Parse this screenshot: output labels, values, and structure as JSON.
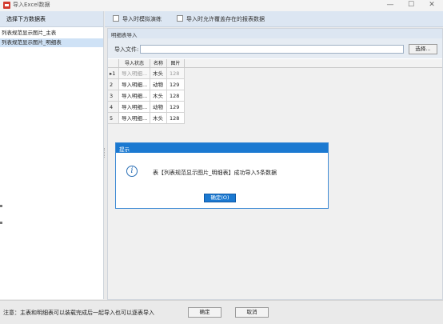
{
  "window": {
    "title": "导入Excel数据",
    "minimize": "—",
    "maximize": "☐",
    "close": "✕"
  },
  "left_panel": {
    "header": "选择下方数据表",
    "items": [
      {
        "label": "列表规范显示图片_主表",
        "selected": false
      },
      {
        "label": "列表规范显示图片_明细表",
        "selected": true
      }
    ]
  },
  "options": {
    "simulate_label": "导入时模拟演练",
    "allow_overwrite_label": "导入时允许覆盖存在的报表数据"
  },
  "group": {
    "title": "明细表导入",
    "file_label": "导入文件:",
    "file_value": "",
    "browse_label": "选择..."
  },
  "grid": {
    "columns": [
      "",
      "导入状态",
      "名称",
      "图片"
    ],
    "rows": [
      {
        "num": "1",
        "status": "导入明细...",
        "name": "木头",
        "pic": "128",
        "current": true
      },
      {
        "num": "2",
        "status": "导入明细...",
        "name": "动物",
        "pic": "129",
        "current": false
      },
      {
        "num": "3",
        "status": "导入明细...",
        "name": "木头",
        "pic": "128",
        "current": false
      },
      {
        "num": "4",
        "status": "导入明细...",
        "name": "动物",
        "pic": "129",
        "current": false
      },
      {
        "num": "5",
        "status": "导入明细...",
        "name": "木头",
        "pic": "128",
        "current": false
      }
    ]
  },
  "message_box": {
    "title": "提示",
    "icon": "info-icon",
    "text": "表【列表规范显示图片_明细表】成功导入5条数据",
    "ok_label": "确定(O)"
  },
  "bottom": {
    "note": "注意：主表和明细表可以装载完成后一起导入也可以逐表导入",
    "confirm_label": "确定",
    "cancel_label": "取消"
  },
  "colors": {
    "accent": "#1b79d1",
    "panel_header": "#dce6f2",
    "selection": "#cfe2f6"
  }
}
